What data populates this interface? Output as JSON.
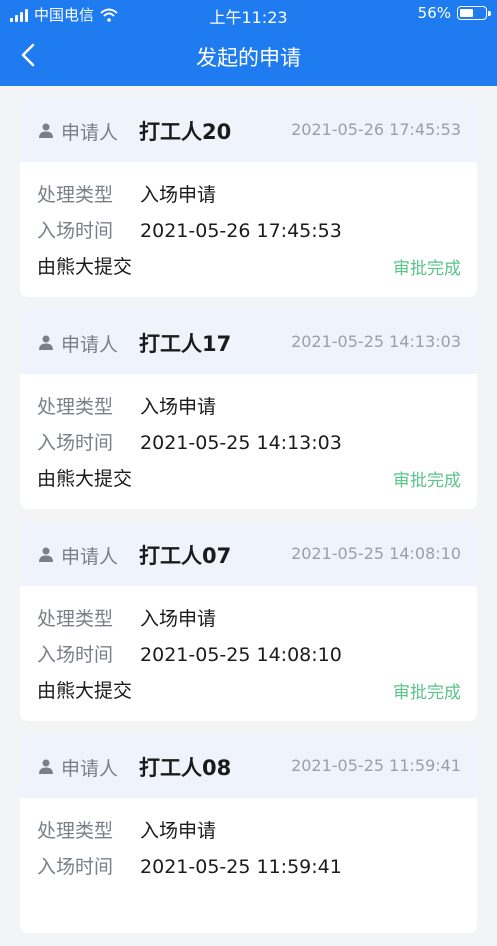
{
  "statusbar": {
    "carrier": "中国电信",
    "time": "上午11:23",
    "battery": "56%",
    "battery_level": 0.56
  },
  "navbar": {
    "title": "发起的申请"
  },
  "labels": {
    "applicant": "申请人",
    "type": "处理类型",
    "entry_time": "入场时间"
  },
  "cards": [
    {
      "name": "打工人20",
      "head_time": "2021-05-26 17:45:53",
      "type": "入场申请",
      "entry_time": "2021-05-26 17:45:53",
      "submitter": "由熊大提交",
      "status": "审批完成"
    },
    {
      "name": "打工人17",
      "head_time": "2021-05-25 14:13:03",
      "type": "入场申请",
      "entry_time": "2021-05-25 14:13:03",
      "submitter": "由熊大提交",
      "status": "审批完成"
    },
    {
      "name": "打工人07",
      "head_time": "2021-05-25 14:08:10",
      "type": "入场申请",
      "entry_time": "2021-05-25 14:08:10",
      "submitter": "由熊大提交",
      "status": "审批完成"
    },
    {
      "name": "打工人08",
      "head_time": "2021-05-25 11:59:41",
      "type": "入场申请",
      "entry_time": "2021-05-25 11:59:41",
      "submitter": "",
      "status": ""
    }
  ],
  "colors": {
    "primary": "#1f7cf0",
    "status_done": "#5ac48a",
    "card_header_bg": "#eef3fc"
  }
}
